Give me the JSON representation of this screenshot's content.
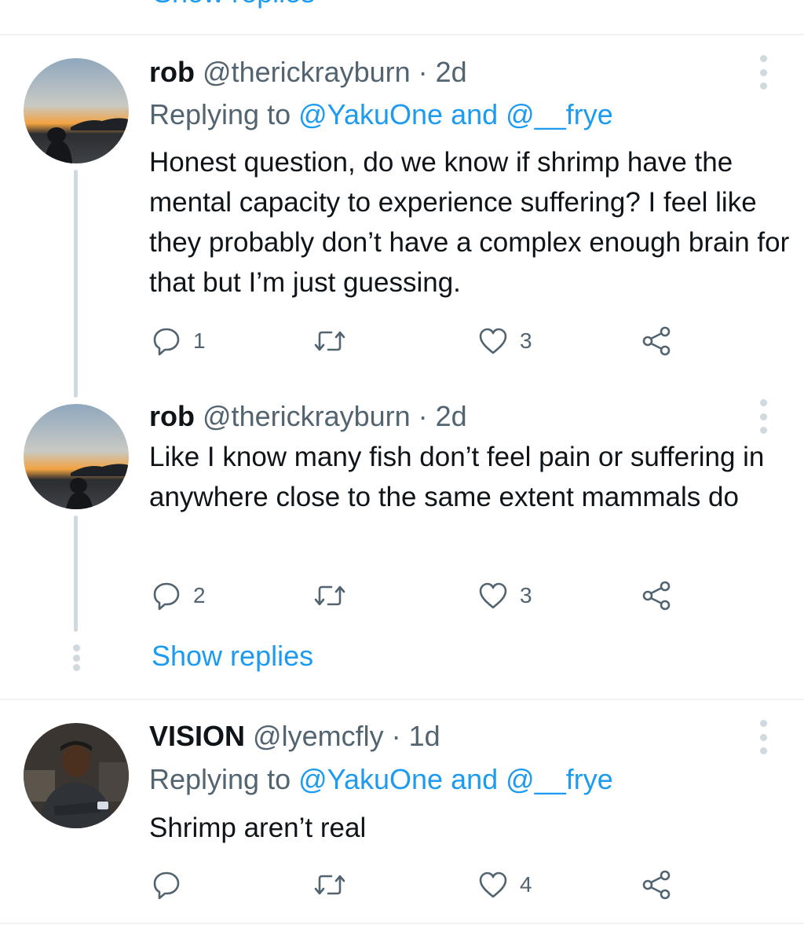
{
  "top": {
    "show_replies_partial": "Show replies"
  },
  "tweets": [
    {
      "display_name": "rob",
      "handle": "@therickrayburn",
      "time": "· 2d",
      "replying_prefix": "Replying to ",
      "mention_1": "@YakuOne",
      "and_word": " and ",
      "mention_2": "@__frye",
      "text": "Honest question, do we know if shrimp have the mental capacity to experience suffering? I feel like they probably don’t have a complex enough brain for that but I’m just guessing.",
      "reply_count": "1",
      "retweet_count": "",
      "like_count": "3"
    },
    {
      "display_name": "rob",
      "handle": "@therickrayburn",
      "time": "· 2d",
      "text": "Like I know many fish don’t feel pain or suffering in anywhere close to the same extent mammals do",
      "reply_count": "2",
      "retweet_count": "",
      "like_count": "3"
    },
    {
      "display_name": "VISION",
      "handle": "@lyemcfly",
      "time": "· 1d",
      "replying_prefix": "Replying to ",
      "mention_1": "@YakuOne",
      "and_word": " and ",
      "mention_2": "@__frye",
      "text": "Shrimp aren’t real",
      "reply_count": "",
      "retweet_count": "",
      "like_count": "4"
    }
  ],
  "show_replies_label": "Show replies",
  "icons": {
    "reply": "speech-bubble-icon",
    "retweet": "retweet-icon",
    "like": "heart-icon",
    "share": "share-icon",
    "more": "more-vertical-icon"
  },
  "colors": {
    "text": "#0f1419",
    "secondary": "#536471",
    "link": "#1d9bf0",
    "divider": "#eff3f4",
    "thread_line": "#cfd9de"
  }
}
